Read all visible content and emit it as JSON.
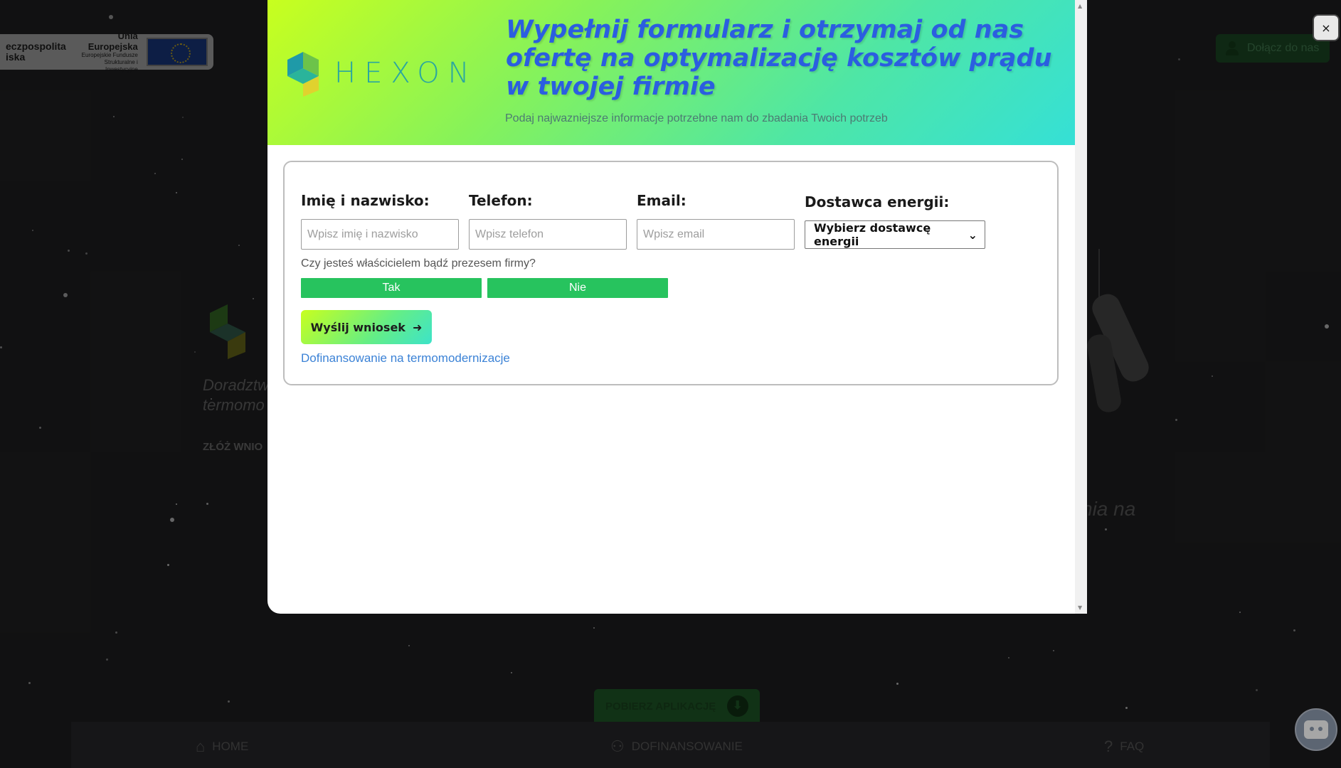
{
  "background": {
    "eu_banner": {
      "left_text": "eczpospolita\niska",
      "title": "Unia Europejska",
      "subtitle": "Europejskie Fundusze Strukturalne i Inwestycyjne"
    },
    "join_button_label": "Dołącz do nas",
    "hero_text_line1": "Doradztw",
    "hero_text_line2": "termomo",
    "hero_cta": "ZŁÓŻ WNIO",
    "right_text": "nia na",
    "download_app_label": "POBIERZ APLIKACJĘ",
    "nav": {
      "home": "HOME",
      "funding": "DOFINANSOWANIE",
      "faq": "FAQ"
    }
  },
  "modal": {
    "logo_text": "HEXON",
    "headline": "Wypełnij formularz i otrzymaj od nas ofertę na optymalizację kosztów prądu w twojej firmie",
    "subline": "Podaj najwazniejsze informacje potrzebne nam do zbadania Twoich potrzeb",
    "form": {
      "name_label": "Imię i nazwisko:",
      "name_placeholder": "Wpisz imię i nazwisko",
      "phone_label": "Telefon:",
      "phone_placeholder": "Wpisz telefon",
      "email_label": "Email:",
      "email_placeholder": "Wpisz email",
      "supplier_label": "Dostawca energii:",
      "supplier_selected": "Wybierz dostawcę energii",
      "owner_question": "Czy jesteś właścicielem bądź prezesem firmy?",
      "yes_label": "Tak",
      "no_label": "Nie",
      "submit_label": "Wyślij wniosek",
      "link_text": "Dofinansowanie na termomodernizacje"
    },
    "close_label": "×"
  },
  "colors": {
    "header_gradient_start": "#c8ff1e",
    "header_gradient_end": "#35e0d6",
    "headline": "#2b5ee0",
    "choice_green": "#27c35e",
    "link_blue": "#3b82d6"
  }
}
